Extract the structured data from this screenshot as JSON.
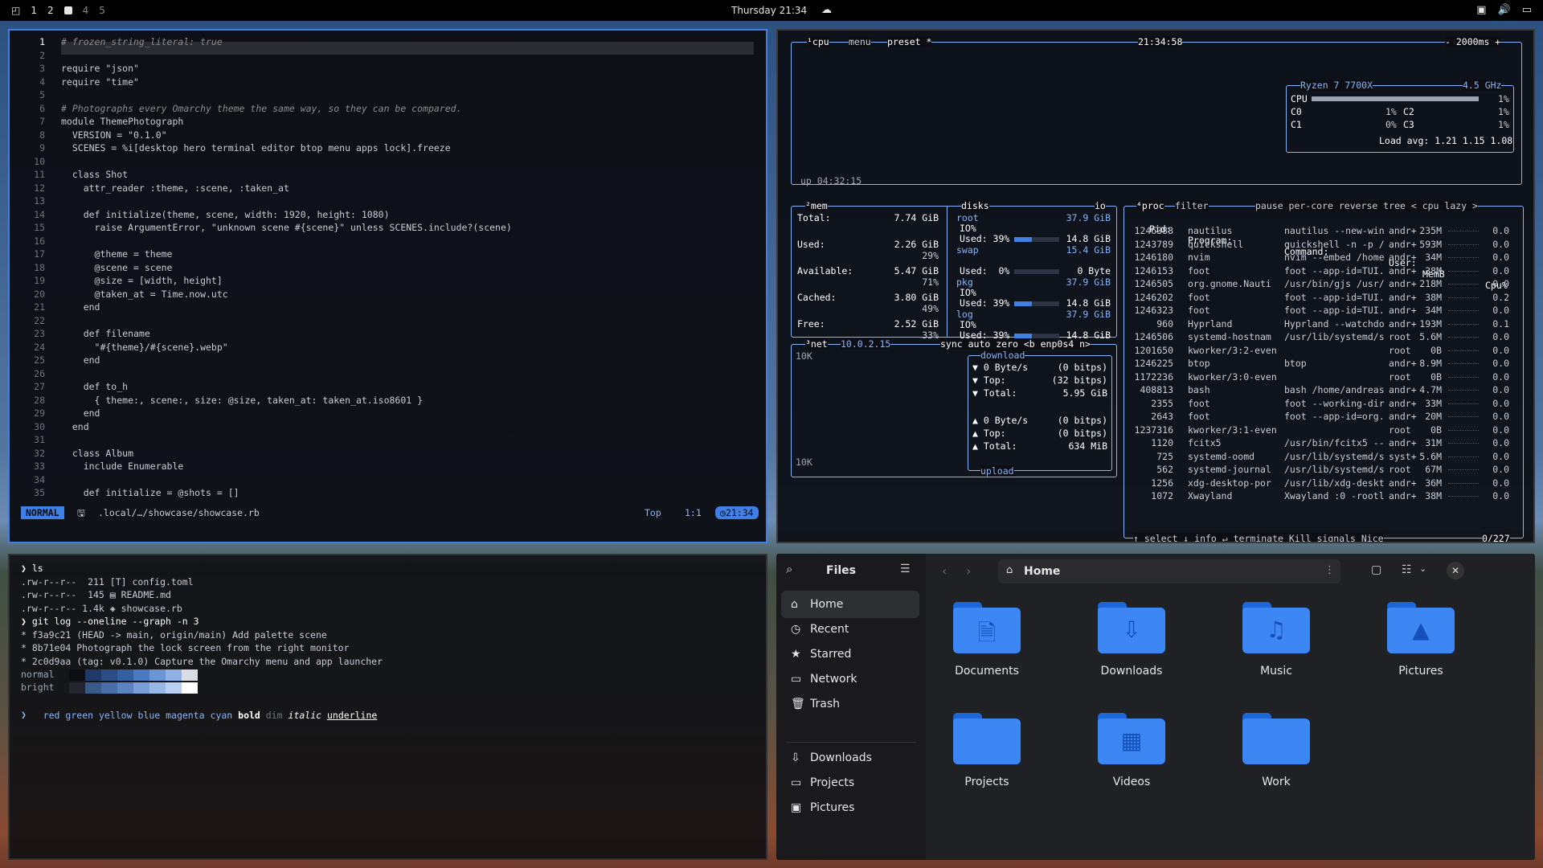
{
  "topbar": {
    "workspaces": [
      "1",
      "2",
      "4",
      "5"
    ],
    "clock": "Thursday 21:34"
  },
  "nvim": {
    "lines": [
      {
        "n": "1",
        "t": "# frozen_string_literal: true",
        "c": "cm"
      },
      {
        "n": "2",
        "t": "",
        "c": "kw"
      },
      {
        "n": "3",
        "t": "require \"json\"",
        "c": "kw"
      },
      {
        "n": "4",
        "t": "require \"time\"",
        "c": "kw"
      },
      {
        "n": "5",
        "t": "",
        "c": "kw"
      },
      {
        "n": "6",
        "t": "# Photographs every Omarchy theme the same way, so they can be compared.",
        "c": "cm"
      },
      {
        "n": "7",
        "t": "module ThemePhotograph",
        "c": "kw"
      },
      {
        "n": "8",
        "t": "  VERSION = \"0.1.0\"",
        "c": "kw"
      },
      {
        "n": "9",
        "t": "  SCENES = %i[desktop hero terminal editor btop menu apps lock].freeze",
        "c": "kw"
      },
      {
        "n": "10",
        "t": "",
        "c": "kw"
      },
      {
        "n": "11",
        "t": "  class Shot",
        "c": "kw"
      },
      {
        "n": "12",
        "t": "    attr_reader :theme, :scene, :taken_at",
        "c": "kw"
      },
      {
        "n": "13",
        "t": "",
        "c": "kw"
      },
      {
        "n": "14",
        "t": "    def initialize(theme, scene, width: 1920, height: 1080)",
        "c": "kw"
      },
      {
        "n": "15",
        "t": "      raise ArgumentError, \"unknown scene #{scene}\" unless SCENES.include?(scene)",
        "c": "kw"
      },
      {
        "n": "16",
        "t": "",
        "c": "kw"
      },
      {
        "n": "17",
        "t": "      @theme = theme",
        "c": "kw"
      },
      {
        "n": "18",
        "t": "      @scene = scene",
        "c": "kw"
      },
      {
        "n": "19",
        "t": "      @size = [width, height]",
        "c": "kw"
      },
      {
        "n": "20",
        "t": "      @taken_at = Time.now.utc",
        "c": "kw"
      },
      {
        "n": "21",
        "t": "    end",
        "c": "kw"
      },
      {
        "n": "22",
        "t": "",
        "c": "kw"
      },
      {
        "n": "23",
        "t": "    def filename",
        "c": "kw"
      },
      {
        "n": "24",
        "t": "      \"#{theme}/#{scene}.webp\"",
        "c": "kw"
      },
      {
        "n": "25",
        "t": "    end",
        "c": "kw"
      },
      {
        "n": "26",
        "t": "",
        "c": "kw"
      },
      {
        "n": "27",
        "t": "    def to_h",
        "c": "kw"
      },
      {
        "n": "28",
        "t": "      { theme:, scene:, size: @size, taken_at: taken_at.iso8601 }",
        "c": "kw"
      },
      {
        "n": "29",
        "t": "    end",
        "c": "kw"
      },
      {
        "n": "30",
        "t": "  end",
        "c": "kw"
      },
      {
        "n": "31",
        "t": "",
        "c": "kw"
      },
      {
        "n": "32",
        "t": "  class Album",
        "c": "kw"
      },
      {
        "n": "33",
        "t": "    include Enumerable",
        "c": "kw"
      },
      {
        "n": "34",
        "t": "",
        "c": "kw"
      },
      {
        "n": "35",
        "t": "    def initialize = @shots = []",
        "c": "kw"
      }
    ],
    "mode": "NORMAL",
    "file_path": ".local/…/showcase/showcase.rb",
    "position_label": "Top",
    "cursor": "1:1",
    "time": "21:34"
  },
  "btop": {
    "cpu_header": "¹cpu",
    "menu": "menu",
    "preset": "preset *",
    "clock": "21:34:58",
    "interval": "- 2000ms +",
    "cpu_model": "Ryzen 7 7700X",
    "cpu_freq": "4.5 GHz",
    "cpu_rows": [
      "CPU",
      "C0",
      "C1"
    ],
    "cpu_pct": [
      "1%",
      "1%",
      "0%"
    ],
    "cpu_rows2": [
      "C2",
      "C3"
    ],
    "cpu_pct2": [
      "1%",
      "1%"
    ],
    "load_avg": "Load avg: 1.21 1.15 1.08",
    "uptime": "up 04:32:15",
    "mem": {
      "title": "²mem",
      "rows": [
        {
          "label": "Total:",
          "value": "7.74 GiB",
          "pct": ""
        },
        {
          "label": "Used:",
          "value": "2.26 GiB",
          "pct": "29%"
        },
        {
          "label": "Available:",
          "value": "5.47 GiB",
          "pct": "71%"
        },
        {
          "label": "Cached:",
          "value": "3.80 GiB",
          "pct": "49%"
        },
        {
          "label": "Free:",
          "value": "2.52 GiB",
          "pct": "33%"
        }
      ]
    },
    "disks": {
      "title": "disks",
      "io": "io",
      "items": [
        {
          "name": "root",
          "size": "37.9 GiB",
          "io": "IO%",
          "used_label": "Used: 39%",
          "used": "14.8 GiB",
          "used_pct": 39
        },
        {
          "name": "swap",
          "size": "15.4 GiB",
          "io": "",
          "used_label": "Used:  0%",
          "used": "0 Byte",
          "used_pct": 0
        },
        {
          "name": "pkg",
          "size": "37.9 GiB",
          "io": "IO%",
          "used_label": "Used: 39%",
          "used": "14.8 GiB",
          "used_pct": 39
        },
        {
          "name": "log",
          "size": "37.9 GiB",
          "io": "IO%",
          "used_label": "Used: 39%",
          "used": "14.8 GiB",
          "used_pct": 39
        }
      ]
    },
    "net": {
      "title": "³net",
      "ip": "10.0.2.15",
      "opts": "sync auto zero <b enp0s4 n>",
      "scale_top": "10K",
      "scale_bottom": "10K",
      "download_title": "download",
      "upload_title": "upload",
      "down": [
        {
          "k": "▼ 0 Byte/s",
          "v": "(0 bitps)"
        },
        {
          "k": "▼ Top:",
          "v": "(32 bitps)"
        },
        {
          "k": "▼ Total:",
          "v": "5.95 GiB"
        }
      ],
      "up": [
        {
          "k": "▲ 0 Byte/s",
          "v": "(0 bitps)"
        },
        {
          "k": "▲ Top:",
          "v": "(0 bitps)"
        },
        {
          "k": "▲ Total:",
          "v": "634 MiB"
        }
      ]
    },
    "proc": {
      "title": "⁴proc",
      "filter": "filter",
      "opts": "pause per-core reverse tree < cpu lazy >",
      "headers": {
        "pid": "Pid:",
        "program": "Program:",
        "command": "Command:",
        "user": "User:",
        "mem": "MemB",
        "cpu": "Cpu%"
      },
      "rows": [
        {
          "pid": "1246388",
          "program": "nautilus",
          "command": "nautilus --new-win",
          "user": "andr+",
          "mem": "235M",
          "cpu": "0.0"
        },
        {
          "pid": "1243789",
          "program": "quickshell",
          "command": "quickshell -n -p /",
          "user": "andr+",
          "mem": "593M",
          "cpu": "0.0"
        },
        {
          "pid": "1246180",
          "program": "nvim",
          "command": "nvim --embed /home",
          "user": "andr+",
          "mem": "34M",
          "cpu": "0.0"
        },
        {
          "pid": "1246153",
          "program": "foot",
          "command": "foot --app-id=TUI.",
          "user": "andr+",
          "mem": "38M",
          "cpu": "0.0"
        },
        {
          "pid": "1246505",
          "program": "org.gnome.Nauti",
          "command": "/usr/bin/gjs /usr/",
          "user": "andr+",
          "mem": "218M",
          "cpu": "0.0"
        },
        {
          "pid": "1246202",
          "program": "foot",
          "command": "foot --app-id=TUI.",
          "user": "andr+",
          "mem": "38M",
          "cpu": "0.2"
        },
        {
          "pid": "1246323",
          "program": "foot",
          "command": "foot --app-id=TUI.",
          "user": "andr+",
          "mem": "34M",
          "cpu": "0.0"
        },
        {
          "pid": "960",
          "program": "Hyprland",
          "command": "Hyprland --watchdo",
          "user": "andr+",
          "mem": "193M",
          "cpu": "0.1"
        },
        {
          "pid": "1246506",
          "program": "systemd-hostnam",
          "command": "/usr/lib/systemd/s",
          "user": "root",
          "mem": "5.6M",
          "cpu": "0.0"
        },
        {
          "pid": "1201650",
          "program": "kworker/3:2-even",
          "command": "",
          "user": "root",
          "mem": "0B",
          "cpu": "0.0"
        },
        {
          "pid": "1246225",
          "program": "btop",
          "command": "btop",
          "user": "andr+",
          "mem": "8.9M",
          "cpu": "0.0"
        },
        {
          "pid": "1172236",
          "program": "kworker/3:0-even",
          "command": "",
          "user": "root",
          "mem": "0B",
          "cpu": "0.0"
        },
        {
          "pid": "408813",
          "program": "bash",
          "command": "bash /home/andreas",
          "user": "andr+",
          "mem": "4.7M",
          "cpu": "0.0"
        },
        {
          "pid": "2355",
          "program": "foot",
          "command": "foot --working-dir",
          "user": "andr+",
          "mem": "33M",
          "cpu": "0.0"
        },
        {
          "pid": "2643",
          "program": "foot",
          "command": "foot --app-id=org.",
          "user": "andr+",
          "mem": "20M",
          "cpu": "0.0"
        },
        {
          "pid": "1237316",
          "program": "kworker/3:1-even",
          "command": "",
          "user": "root",
          "mem": "0B",
          "cpu": "0.0"
        },
        {
          "pid": "1120",
          "program": "fcitx5",
          "command": "/usr/bin/fcitx5 --",
          "user": "andr+",
          "mem": "31M",
          "cpu": "0.0"
        },
        {
          "pid": "725",
          "program": "systemd-oomd",
          "command": "/usr/lib/systemd/s",
          "user": "syst+",
          "mem": "5.6M",
          "cpu": "0.0"
        },
        {
          "pid": "562",
          "program": "systemd-journal",
          "command": "/usr/lib/systemd/s",
          "user": "root",
          "mem": "67M",
          "cpu": "0.0"
        },
        {
          "pid": "1256",
          "program": "xdg-desktop-por",
          "command": "/usr/lib/xdg-deskt",
          "user": "andr+",
          "mem": "36M",
          "cpu": "0.0"
        },
        {
          "pid": "1072",
          "program": "Xwayland",
          "command": "Xwayland :0 -rootl",
          "user": "andr+",
          "mem": "38M",
          "cpu": "0.0"
        }
      ],
      "footer": "↑ select ↓ info ↵ terminate Kill signals Nice",
      "count": "0/227"
    }
  },
  "terminal": {
    "lines": [
      {
        "t": "❯ ls",
        "c": "#ffffff"
      },
      {
        "t": ".rw-r--r--  211 [T] config.toml",
        "c": "#c7cdd6"
      },
      {
        "t": ".rw-r--r--  145 ▤ README.md",
        "c": "#c7cdd6"
      },
      {
        "t": ".rw-r--r-- 1.4k ◈ showcase.rb",
        "c": "#c7cdd6"
      },
      {
        "t": "❯ git log --oneline --graph -n 3",
        "c": "#ffffff"
      },
      {
        "t": "* f3a9c21 (HEAD -> main, origin/main) Add palette scene",
        "c": "#c7cdd6"
      },
      {
        "t": "* 8b71e04 Photograph the lock screen from the right monitor",
        "c": "#c7cdd6"
      },
      {
        "t": "* 2c0d9aa (tag: v0.1.0) Capture the Omarchy menu and app launcher",
        "c": "#c7cdd6"
      }
    ],
    "palette_normal_label": "normal",
    "palette_bright_label": "bright",
    "palette_normal": [
      "#0c0e14",
      "#1f3a68",
      "#2a4d86",
      "#3560a0",
      "#4a7bc2",
      "#6a96d6",
      "#8fb3e6",
      "#d9dee6"
    ],
    "palette_bright": [
      "#23262e",
      "#3a5a8a",
      "#4a6ea8",
      "#5b83c0",
      "#7aa0d8",
      "#98b8e6",
      "#b9d0f2",
      "#ffffff"
    ],
    "styles": [
      "red",
      "green",
      "yellow",
      "blue",
      "magenta",
      "cyan",
      "bold",
      "dim",
      "italic",
      "underline"
    ],
    "prompt": "❯"
  },
  "files": {
    "title": "Files",
    "location": "Home",
    "sidebar": [
      {
        "label": "Home",
        "icon": "⌂"
      },
      {
        "label": "Recent",
        "icon": "◷"
      },
      {
        "label": "Starred",
        "icon": "★"
      },
      {
        "label": "Network",
        "icon": "▭"
      },
      {
        "label": "Trash",
        "icon": "🗑"
      },
      {
        "label": "Downloads",
        "icon": "⇩"
      },
      {
        "label": "Projects",
        "icon": "▭"
      },
      {
        "label": "Pictures",
        "icon": "▣"
      }
    ],
    "folders": [
      {
        "label": "Documents",
        "glyph": "🗎"
      },
      {
        "label": "Downloads",
        "glyph": "⇩"
      },
      {
        "label": "Music",
        "glyph": "♫"
      },
      {
        "label": "Pictures",
        "glyph": "▲"
      },
      {
        "label": "Projects",
        "glyph": ""
      },
      {
        "label": "Videos",
        "glyph": "▦"
      },
      {
        "label": "Work",
        "glyph": ""
      }
    ]
  }
}
